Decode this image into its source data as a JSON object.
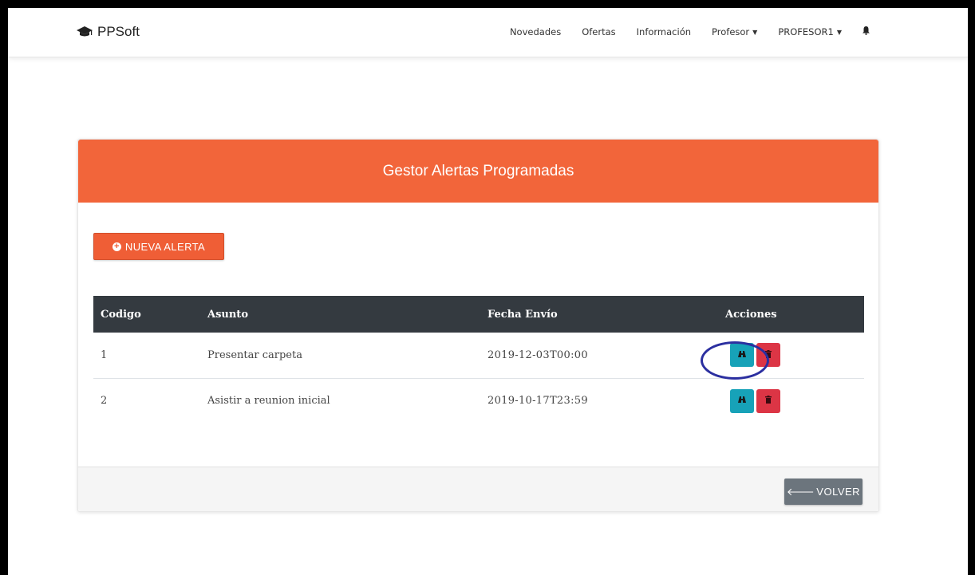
{
  "brand": {
    "name": "PPSoft",
    "icon": "graduation-cap-icon"
  },
  "nav": {
    "items": [
      {
        "label": "Novedades",
        "dropdown": false
      },
      {
        "label": "Ofertas",
        "dropdown": false
      },
      {
        "label": "Información",
        "dropdown": false
      },
      {
        "label": "Profesor",
        "dropdown": true
      },
      {
        "label": "PROFESOR1",
        "dropdown": true
      }
    ],
    "notification_icon": "bell-icon"
  },
  "panel": {
    "title": "Gestor Alertas Programadas",
    "new_alert_label": "NUEVA ALERTA",
    "back_label": "VOLVER"
  },
  "table": {
    "headers": [
      "Codigo",
      "Asunto",
      "Fecha Envío",
      "Acciones"
    ],
    "rows": [
      {
        "codigo": "1",
        "asunto": "Presentar carpeta",
        "fecha": "2019-12-03T00:00"
      },
      {
        "codigo": "2",
        "asunto": "Asistir a reunion inicial",
        "fecha": "2019-10-17T23:59"
      }
    ]
  },
  "colors": {
    "header_orange": "#f2653a",
    "table_head": "#343a40",
    "view_button": "#17a2b8",
    "delete_button": "#dc3545",
    "back_button": "#6c757d",
    "highlight_circle": "#2b2fa0"
  }
}
